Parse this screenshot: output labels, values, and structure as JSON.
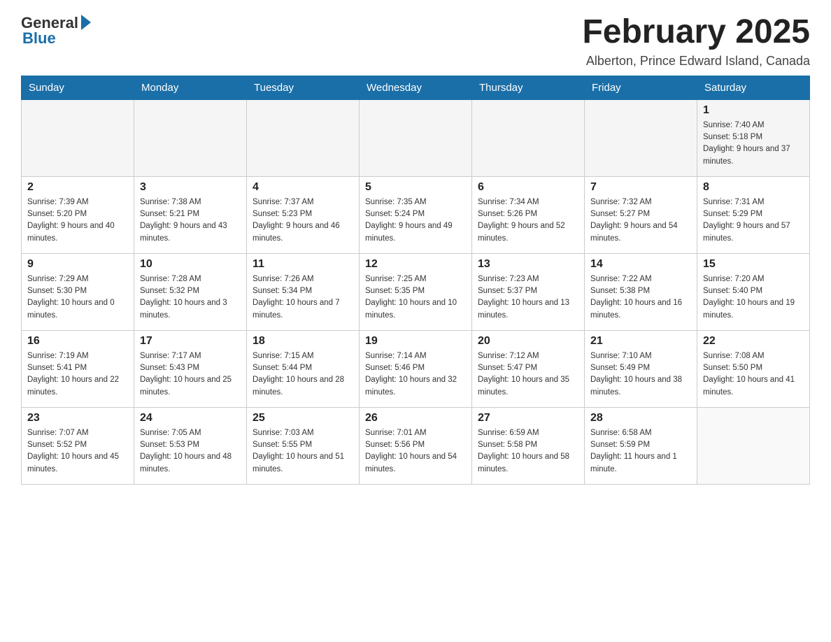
{
  "header": {
    "logo_general": "General",
    "logo_blue": "Blue",
    "month_title": "February 2025",
    "location": "Alberton, Prince Edward Island, Canada"
  },
  "weekdays": [
    "Sunday",
    "Monday",
    "Tuesday",
    "Wednesday",
    "Thursday",
    "Friday",
    "Saturday"
  ],
  "weeks": [
    [
      {
        "day": "",
        "info": ""
      },
      {
        "day": "",
        "info": ""
      },
      {
        "day": "",
        "info": ""
      },
      {
        "day": "",
        "info": ""
      },
      {
        "day": "",
        "info": ""
      },
      {
        "day": "",
        "info": ""
      },
      {
        "day": "1",
        "info": "Sunrise: 7:40 AM\nSunset: 5:18 PM\nDaylight: 9 hours and 37 minutes."
      }
    ],
    [
      {
        "day": "2",
        "info": "Sunrise: 7:39 AM\nSunset: 5:20 PM\nDaylight: 9 hours and 40 minutes."
      },
      {
        "day": "3",
        "info": "Sunrise: 7:38 AM\nSunset: 5:21 PM\nDaylight: 9 hours and 43 minutes."
      },
      {
        "day": "4",
        "info": "Sunrise: 7:37 AM\nSunset: 5:23 PM\nDaylight: 9 hours and 46 minutes."
      },
      {
        "day": "5",
        "info": "Sunrise: 7:35 AM\nSunset: 5:24 PM\nDaylight: 9 hours and 49 minutes."
      },
      {
        "day": "6",
        "info": "Sunrise: 7:34 AM\nSunset: 5:26 PM\nDaylight: 9 hours and 52 minutes."
      },
      {
        "day": "7",
        "info": "Sunrise: 7:32 AM\nSunset: 5:27 PM\nDaylight: 9 hours and 54 minutes."
      },
      {
        "day": "8",
        "info": "Sunrise: 7:31 AM\nSunset: 5:29 PM\nDaylight: 9 hours and 57 minutes."
      }
    ],
    [
      {
        "day": "9",
        "info": "Sunrise: 7:29 AM\nSunset: 5:30 PM\nDaylight: 10 hours and 0 minutes."
      },
      {
        "day": "10",
        "info": "Sunrise: 7:28 AM\nSunset: 5:32 PM\nDaylight: 10 hours and 3 minutes."
      },
      {
        "day": "11",
        "info": "Sunrise: 7:26 AM\nSunset: 5:34 PM\nDaylight: 10 hours and 7 minutes."
      },
      {
        "day": "12",
        "info": "Sunrise: 7:25 AM\nSunset: 5:35 PM\nDaylight: 10 hours and 10 minutes."
      },
      {
        "day": "13",
        "info": "Sunrise: 7:23 AM\nSunset: 5:37 PM\nDaylight: 10 hours and 13 minutes."
      },
      {
        "day": "14",
        "info": "Sunrise: 7:22 AM\nSunset: 5:38 PM\nDaylight: 10 hours and 16 minutes."
      },
      {
        "day": "15",
        "info": "Sunrise: 7:20 AM\nSunset: 5:40 PM\nDaylight: 10 hours and 19 minutes."
      }
    ],
    [
      {
        "day": "16",
        "info": "Sunrise: 7:19 AM\nSunset: 5:41 PM\nDaylight: 10 hours and 22 minutes."
      },
      {
        "day": "17",
        "info": "Sunrise: 7:17 AM\nSunset: 5:43 PM\nDaylight: 10 hours and 25 minutes."
      },
      {
        "day": "18",
        "info": "Sunrise: 7:15 AM\nSunset: 5:44 PM\nDaylight: 10 hours and 28 minutes."
      },
      {
        "day": "19",
        "info": "Sunrise: 7:14 AM\nSunset: 5:46 PM\nDaylight: 10 hours and 32 minutes."
      },
      {
        "day": "20",
        "info": "Sunrise: 7:12 AM\nSunset: 5:47 PM\nDaylight: 10 hours and 35 minutes."
      },
      {
        "day": "21",
        "info": "Sunrise: 7:10 AM\nSunset: 5:49 PM\nDaylight: 10 hours and 38 minutes."
      },
      {
        "day": "22",
        "info": "Sunrise: 7:08 AM\nSunset: 5:50 PM\nDaylight: 10 hours and 41 minutes."
      }
    ],
    [
      {
        "day": "23",
        "info": "Sunrise: 7:07 AM\nSunset: 5:52 PM\nDaylight: 10 hours and 45 minutes."
      },
      {
        "day": "24",
        "info": "Sunrise: 7:05 AM\nSunset: 5:53 PM\nDaylight: 10 hours and 48 minutes."
      },
      {
        "day": "25",
        "info": "Sunrise: 7:03 AM\nSunset: 5:55 PM\nDaylight: 10 hours and 51 minutes."
      },
      {
        "day": "26",
        "info": "Sunrise: 7:01 AM\nSunset: 5:56 PM\nDaylight: 10 hours and 54 minutes."
      },
      {
        "day": "27",
        "info": "Sunrise: 6:59 AM\nSunset: 5:58 PM\nDaylight: 10 hours and 58 minutes."
      },
      {
        "day": "28",
        "info": "Sunrise: 6:58 AM\nSunset: 5:59 PM\nDaylight: 11 hours and 1 minute."
      },
      {
        "day": "",
        "info": ""
      }
    ]
  ]
}
